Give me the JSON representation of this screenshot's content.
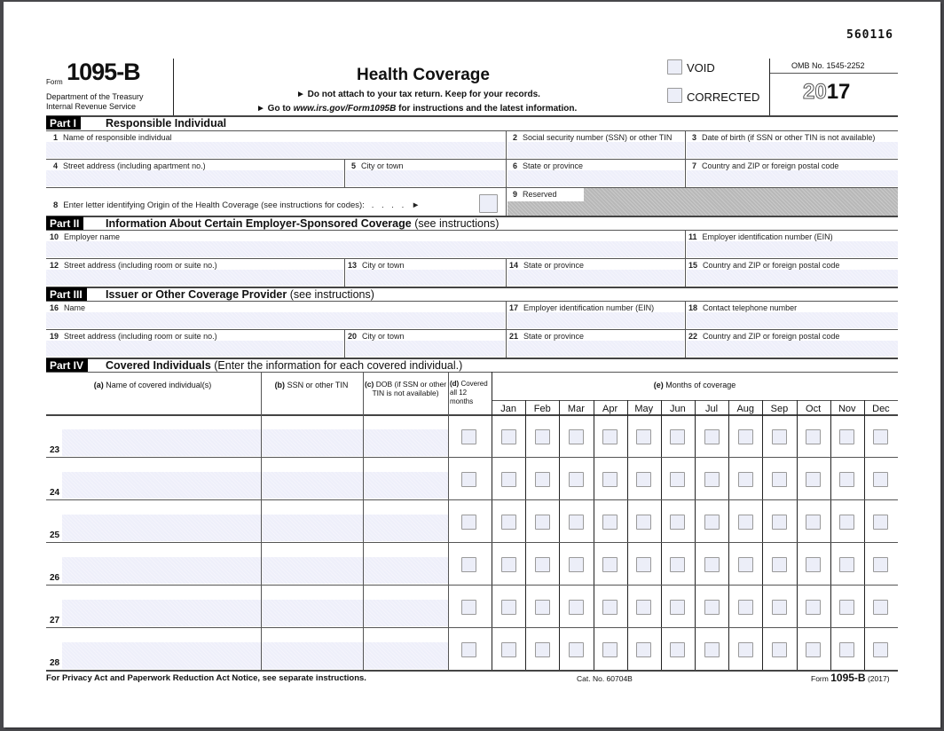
{
  "form_id_code": "560116",
  "header": {
    "form_prefix": "Form",
    "form_number": "1095-B",
    "agency_line1": "Department of the Treasury",
    "agency_line2": "Internal Revenue Service",
    "title": "Health Coverage",
    "instruction1": "► Do not attach to your tax return. Keep for your records.",
    "instruction2_pre": "► Go to ",
    "instruction2_url": "www.irs.gov/Form1095B",
    "instruction2_post": " for instructions and the latest information.",
    "void_label": "VOID",
    "corrected_label": "CORRECTED",
    "omb": "OMB No. 1545-2252",
    "year_outline": "20",
    "year_bold": "17"
  },
  "part1": {
    "tag": "Part I",
    "title": "Responsible Individual",
    "fields": [
      {
        "num": "1",
        "label": "Name of responsible individual"
      },
      {
        "num": "2",
        "label": "Social security number (SSN) or other TIN"
      },
      {
        "num": "3",
        "label": "Date of birth (if SSN or other TIN is not available)"
      },
      {
        "num": "4",
        "label": "Street address (including apartment no.)"
      },
      {
        "num": "5",
        "label": "City or town"
      },
      {
        "num": "6",
        "label": "State or province"
      },
      {
        "num": "7",
        "label": "Country and ZIP or foreign postal code"
      }
    ],
    "line8_num": "8",
    "line8_label": "Enter letter identifying Origin of the Health Coverage (see instructions for codes):",
    "line8_dots": ". . . . ►",
    "line9_num": "9",
    "line9_label": "Reserved"
  },
  "part2": {
    "tag": "Part II",
    "title": "Information About Certain Employer-Sponsored Coverage",
    "title_suffix": " (see instructions)",
    "fields": [
      {
        "num": "10",
        "label": "Employer name"
      },
      {
        "num": "11",
        "label": "Employer identification number (EIN)"
      },
      {
        "num": "12",
        "label": "Street address (including room or suite no.)"
      },
      {
        "num": "13",
        "label": "City or town"
      },
      {
        "num": "14",
        "label": "State or province"
      },
      {
        "num": "15",
        "label": "Country and ZIP or foreign postal code"
      }
    ]
  },
  "part3": {
    "tag": "Part III",
    "title": "Issuer or Other Coverage Provider",
    "title_suffix": " (see instructions)",
    "fields": [
      {
        "num": "16",
        "label": "Name"
      },
      {
        "num": "17",
        "label": "Employer identification number (EIN)"
      },
      {
        "num": "18",
        "label": "Contact telephone number"
      },
      {
        "num": "19",
        "label": "Street address (including room or suite no.)"
      },
      {
        "num": "20",
        "label": "City or town"
      },
      {
        "num": "21",
        "label": "State or province"
      },
      {
        "num": "22",
        "label": "Country and ZIP or foreign postal code"
      }
    ]
  },
  "part4": {
    "tag": "Part IV",
    "title": "Covered Individuals",
    "title_suffix": " (Enter the information for each covered individual.)",
    "col_a_letter": "(a)",
    "col_a": " Name of covered individual(s)",
    "col_b_letter": "(b)",
    "col_b": " SSN or other TIN",
    "col_c_letter": "(c)",
    "col_c": " DOB (if SSN or other TIN is not available)",
    "col_d_letter": "(d)",
    "col_d": " Covered all 12 months",
    "col_e_letter": "(e)",
    "col_e": " Months of coverage",
    "months": [
      "Jan",
      "Feb",
      "Mar",
      "Apr",
      "May",
      "Jun",
      "Jul",
      "Aug",
      "Sep",
      "Oct",
      "Nov",
      "Dec"
    ],
    "rows": [
      "23",
      "24",
      "25",
      "26",
      "27",
      "28"
    ]
  },
  "footer": {
    "privacy": "For Privacy Act and Paperwork Reduction Act Notice, see separate instructions.",
    "cat": "Cat. No. 60704B",
    "form_prefix": "Form",
    "form_number": "1095-B",
    "form_year": "(2017)"
  }
}
